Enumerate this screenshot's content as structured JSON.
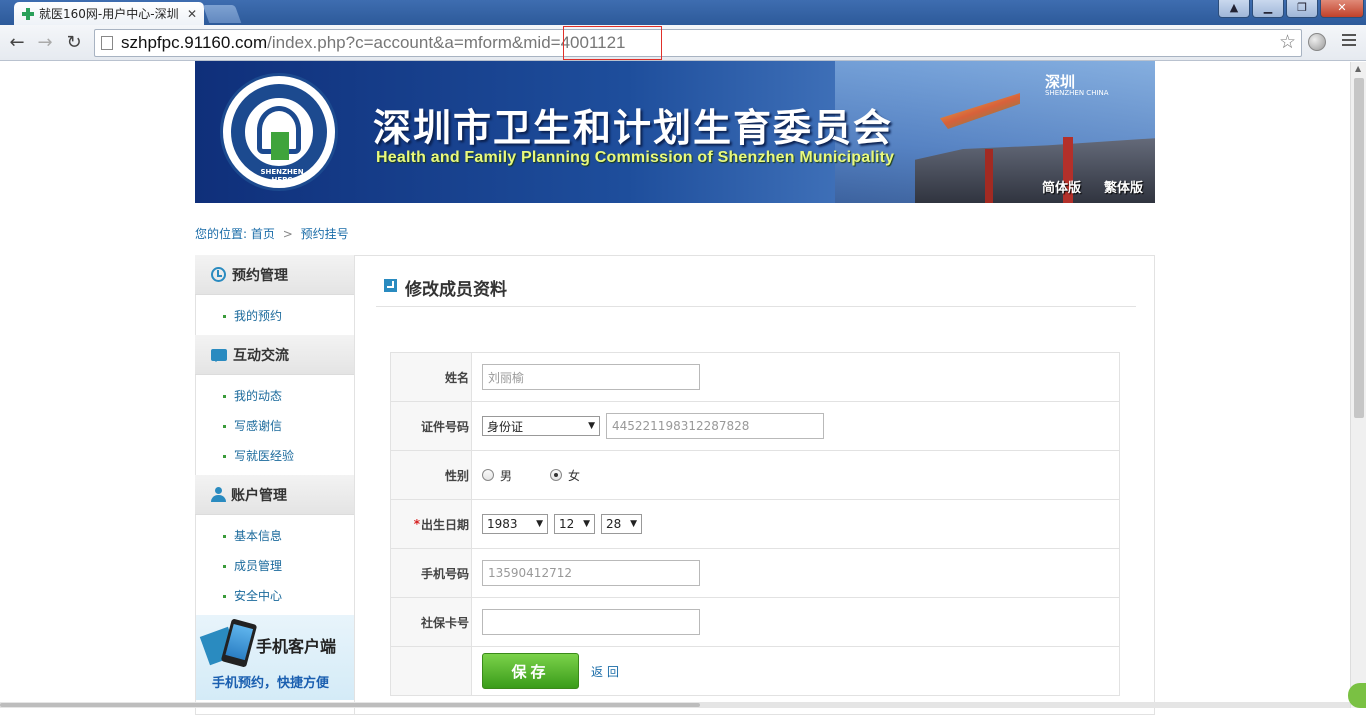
{
  "browser": {
    "tab_title": "就医160网-用户中心-深圳",
    "url_host": "szhpfpc.91160.com",
    "url_path": "/index.php?c=account&a=mform&mid=4001121"
  },
  "banner": {
    "title": "深圳市卫生和计划生育委员会",
    "subtitle": "Health and Family Planning Commission of Shenzhen Municipality",
    "emblem_text": "SHENZHEN HFPC",
    "city_logo": "深圳",
    "city_logo_sub": "SHENZHEN CHINA",
    "simplified": "简体版",
    "traditional": "繁体版"
  },
  "breadcrumb": {
    "prefix": "您的位置:",
    "home": "首页",
    "current": "预约挂号"
  },
  "sidebar": {
    "groups": [
      {
        "title": "预约管理",
        "icon": "clock-icon",
        "items": [
          "我的预约"
        ]
      },
      {
        "title": "互动交流",
        "icon": "chat-icon",
        "items": [
          "我的动态",
          "写感谢信",
          "写就医经验"
        ]
      },
      {
        "title": "账户管理",
        "icon": "user-icon",
        "items": [
          "基本信息",
          "成员管理",
          "安全中心"
        ]
      }
    ],
    "promo_title": "手机客户端",
    "promo_sub": "手机预约，快捷方便"
  },
  "content": {
    "title": "修改成员资料",
    "form": {
      "name_label": "姓名",
      "name_value": "刘丽榆",
      "id_label": "证件号码",
      "id_type": "身份证",
      "id_number": "445221198312287828",
      "gender_label": "性别",
      "gender_male": "男",
      "gender_female": "女",
      "gender_selected": "女",
      "birth_required": "*",
      "birth_label": "出生日期",
      "birth_year": "1983",
      "birth_month": "12",
      "birth_day": "28",
      "phone_label": "手机号码",
      "phone_value": "13590412712",
      "social_label": "社保卡号",
      "social_value": "",
      "save_label": "保存",
      "back_label": "返回"
    }
  },
  "colors": {
    "link": "#1a6ca8",
    "accent": "#2a8bc0",
    "save_button": "#4fb42a",
    "required": "#d62020"
  }
}
